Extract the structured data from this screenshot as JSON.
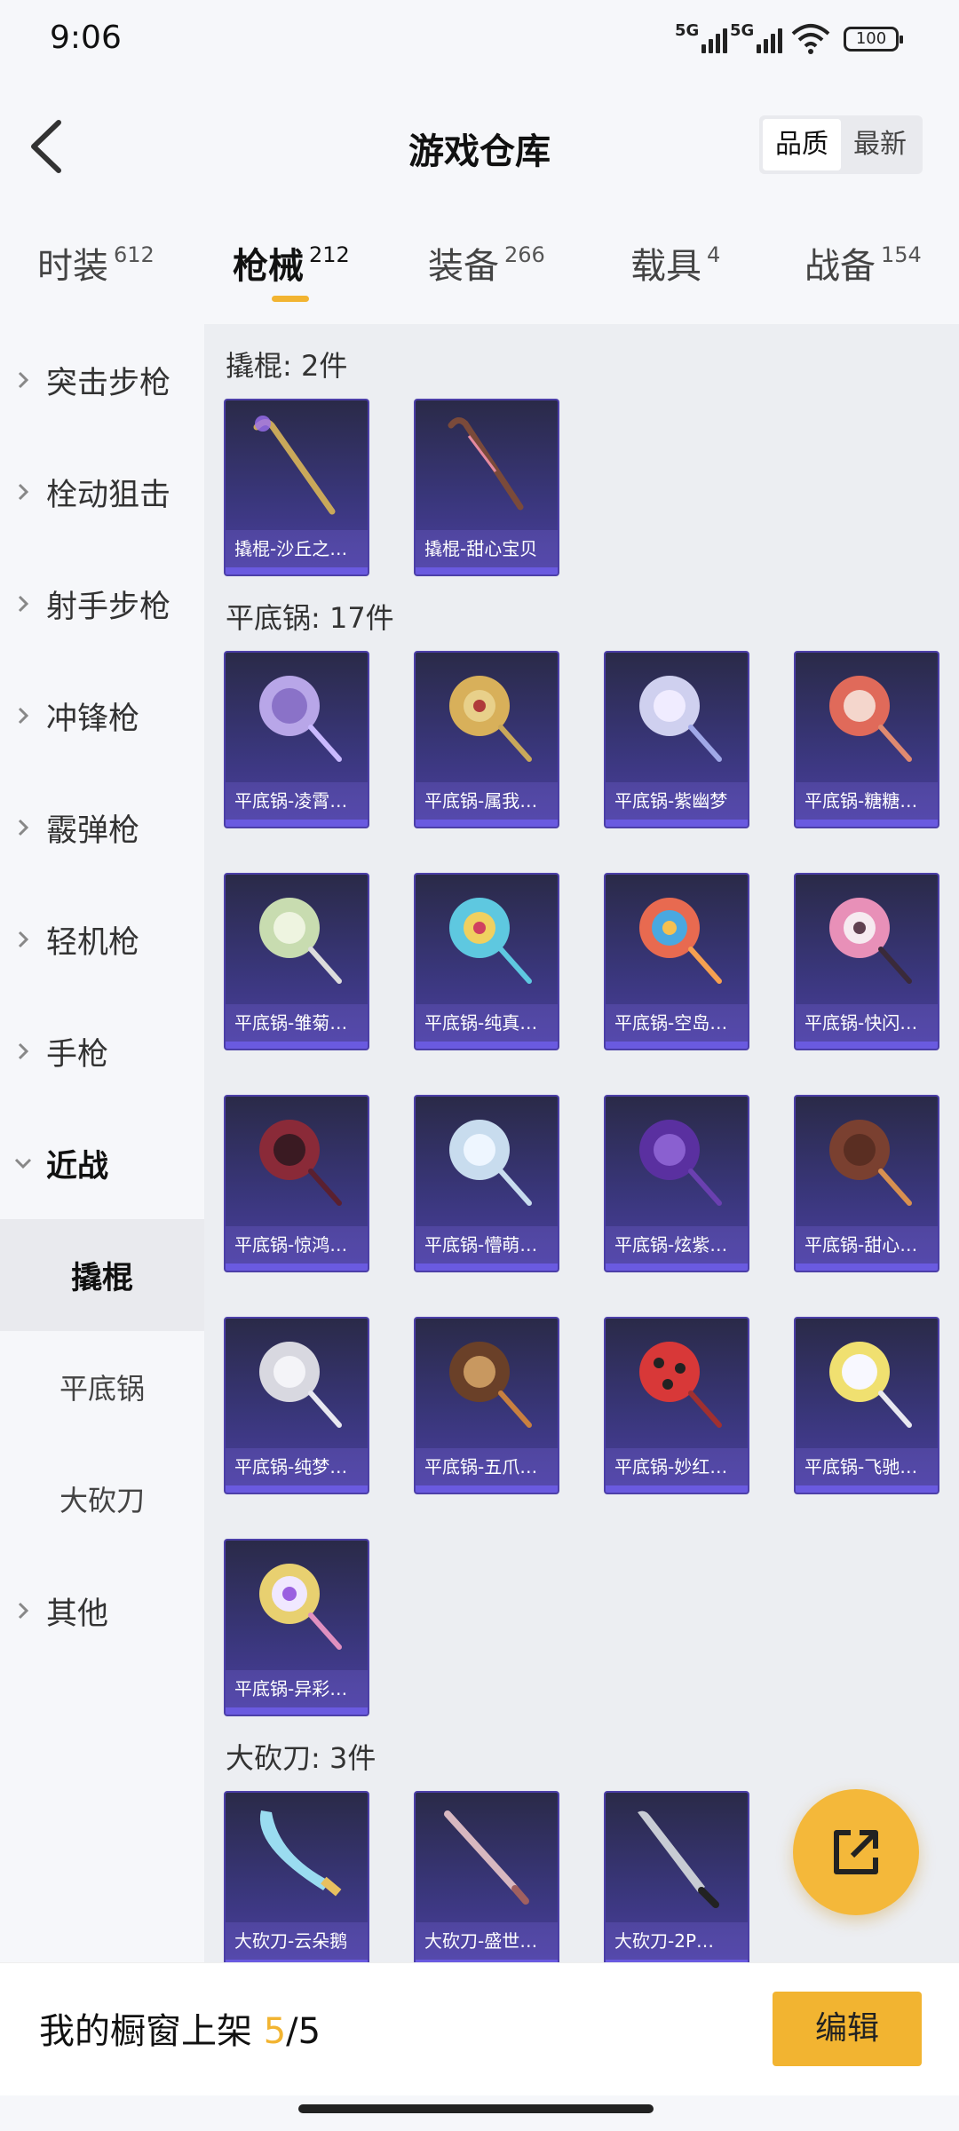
{
  "status": {
    "time": "9:06",
    "net1": "5G",
    "net2": "5G",
    "battery": "100"
  },
  "header": {
    "title": "游戏仓库",
    "sort": {
      "quality": "品质",
      "latest": "最新"
    }
  },
  "tabs": [
    {
      "name": "时装",
      "count": "612"
    },
    {
      "name": "枪械",
      "count": "212"
    },
    {
      "name": "装备",
      "count": "266"
    },
    {
      "name": "载具",
      "count": "4"
    },
    {
      "name": "战备",
      "count": "154"
    }
  ],
  "sidebar": {
    "items": [
      "突击步枪",
      "栓动狙击",
      "射手步枪",
      "冲锋枪",
      "霰弹枪",
      "轻机枪",
      "手枪"
    ],
    "melee": "近战",
    "melee_sub": [
      "撬棍",
      "平底锅",
      "大砍刀"
    ],
    "other": "其他"
  },
  "sections": [
    {
      "title": "撬棍: 2件",
      "items": [
        "撬棍-沙丘之…",
        "撬棍-甜心宝贝"
      ]
    },
    {
      "title": "平底锅: 17件",
      "items": [
        "平底锅-凌霄…",
        "平底锅-属我…",
        "平底锅-紫幽梦",
        "平底锅-糖糖…",
        "平底锅-雏菊…",
        "平底锅-纯真…",
        "平底锅-空岛…",
        "平底锅-快闪…",
        "平底锅-惊鸿…",
        "平底锅-懵萌…",
        "平底锅-炫紫…",
        "平底锅-甜心…",
        "平底锅-纯梦…",
        "平底锅-五爪…",
        "平底锅-妙红…",
        "平底锅-飞驰…",
        "平底锅-异彩…"
      ]
    },
    {
      "title": "大砍刀: 3件",
      "items": [
        "大砍刀-云朵鹅",
        "大砍刀-盛世…",
        "大砍刀-2P…"
      ]
    }
  ],
  "bottom": {
    "label": "我的橱窗上架",
    "used": "5",
    "sep": "/",
    "total": "5",
    "edit": "编辑"
  },
  "colors": {
    "accent": "#f2b431",
    "card_top": "#2a2a48",
    "card_bottom": "#4b3fa0"
  }
}
